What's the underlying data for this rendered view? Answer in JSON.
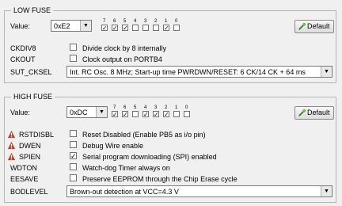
{
  "low_fuse": {
    "title": "LOW FUSE",
    "value_label": "Value:",
    "value": "0xE2",
    "bits": [
      {
        "num": "7",
        "checked": true
      },
      {
        "num": "6",
        "checked": true
      },
      {
        "num": "5",
        "checked": true
      },
      {
        "num": "4",
        "checked": false
      },
      {
        "num": "3",
        "checked": false
      },
      {
        "num": "2",
        "checked": false
      },
      {
        "num": "1",
        "checked": true
      },
      {
        "num": "0",
        "checked": false
      }
    ],
    "default_label": "Default",
    "settings": [
      {
        "name": "CKDIV8",
        "description": "Divide clock by 8 internally",
        "checked": false,
        "warn": false
      },
      {
        "name": "CKOUT",
        "description": "Clock output on PORTB4",
        "checked": false,
        "warn": false
      }
    ],
    "sut_label": "SUT_CKSEL",
    "sut_value": "Int. RC Osc. 8 MHz; Start-up time PWRDWN/RESET: 6 CK/14 CK + 64 ms"
  },
  "high_fuse": {
    "title": "HIGH FUSE",
    "value_label": "Value:",
    "value": "0xDC",
    "bits": [
      {
        "num": "7",
        "checked": true
      },
      {
        "num": "6",
        "checked": true
      },
      {
        "num": "5",
        "checked": false
      },
      {
        "num": "4",
        "checked": true
      },
      {
        "num": "3",
        "checked": true
      },
      {
        "num": "2",
        "checked": true
      },
      {
        "num": "1",
        "checked": false
      },
      {
        "num": "0",
        "checked": false
      }
    ],
    "default_label": "Default",
    "settings": [
      {
        "name": "RSTDISBL",
        "description": "Reset Disabled (Enable PB5 as i/o pin)",
        "checked": false,
        "warn": true
      },
      {
        "name": "DWEN",
        "description": "Debug Wire enable",
        "checked": false,
        "warn": true
      },
      {
        "name": "SPIEN",
        "description": "Serial program downloading (SPI) enabled",
        "checked": true,
        "warn": true
      },
      {
        "name": "WDTON",
        "description": "Watch-dog Timer always on",
        "checked": false,
        "warn": false
      },
      {
        "name": "EESAVE",
        "description": "Preserve EEPROM through the Chip Erase cycle",
        "checked": false,
        "warn": false
      }
    ],
    "bod_label": "BODLEVEL",
    "bod_value": "Brown-out detection at VCC=4.3 V"
  },
  "icons": {
    "default_button": "wand-icon",
    "warning": "warning-icon",
    "dropdown": "chevron-down-icon"
  },
  "colors": {
    "warning": "#d03a1a",
    "panel": "#f0f0f0",
    "border": "#b5b5b5"
  }
}
